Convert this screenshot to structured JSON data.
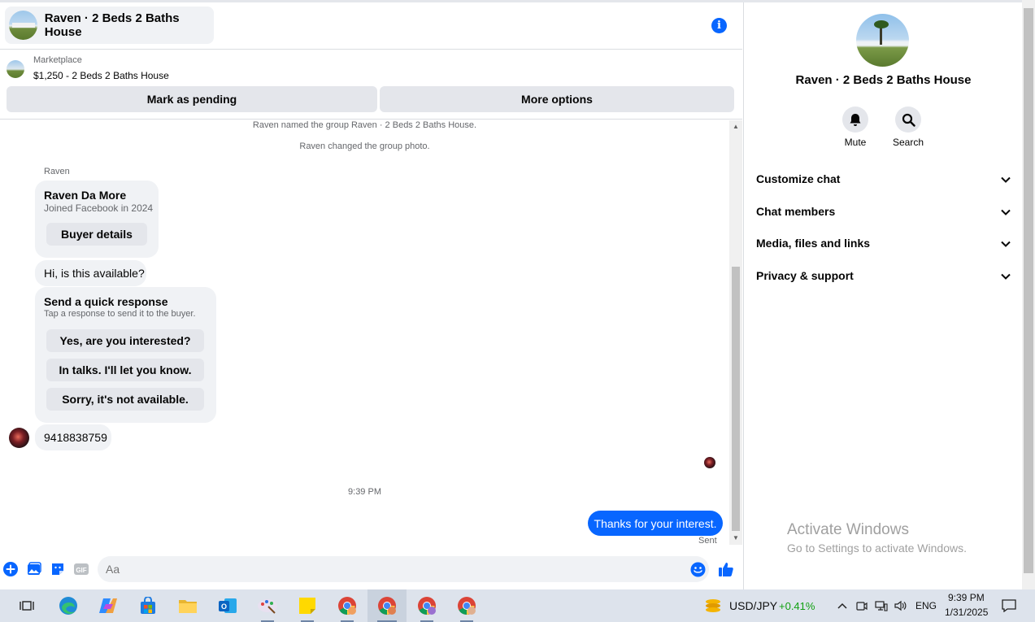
{
  "header": {
    "title": "Raven · 2 Beds 2 Baths House"
  },
  "listing": {
    "source": "Marketplace",
    "price_title": "$1,250 - 2 Beds 2 Baths House",
    "pending_label": "Mark as pending",
    "options_label": "More options"
  },
  "conversation": {
    "sys1": "Raven named the group Raven · 2 Beds 2 Baths House.",
    "sys2": "Raven changed the group photo.",
    "sender": "Raven",
    "card": {
      "name": "Raven Da More",
      "sub": "Joined Facebook in 2024",
      "button": "Buyer details"
    },
    "question": "Hi, is this available?",
    "quick": {
      "title": "Send a quick response",
      "sub": "Tap a response to send it to the buyer.",
      "options": [
        "Yes, are you interested?",
        "In talks. I'll let you know.",
        "Sorry, it's not available."
      ]
    },
    "phone": "9418838759",
    "time": "9:39 PM",
    "sent_message": "Thanks for your interest.",
    "sent_status": "Sent"
  },
  "composer": {
    "placeholder": "Aa"
  },
  "side": {
    "title": "Raven · 2 Beds 2 Baths House",
    "actions": [
      "Mute",
      "Search"
    ],
    "sections": [
      "Customize chat",
      "Chat members",
      "Media, files and links",
      "Privacy & support"
    ]
  },
  "watermark": {
    "line1": "Activate Windows",
    "line2": "Go to Settings to activate Windows."
  },
  "taskbar": {
    "ticker_name": "USD/JPY",
    "ticker_change": "+0.41%",
    "lang": "ENG",
    "time": "9:39 PM",
    "date": "1/31/2025"
  },
  "colors": {
    "accent": "#0866ff",
    "positive": "#10a010",
    "bubble": "#f0f2f5"
  }
}
